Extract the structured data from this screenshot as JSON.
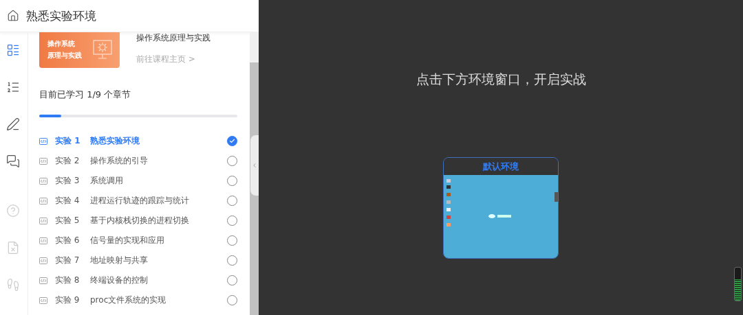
{
  "header": {
    "title": "熟悉实验环境"
  },
  "course": {
    "cover_lines": [
      "操作系统",
      "原理与实践"
    ],
    "name": "操作系统原理与实践",
    "link": "前往课程主页 >"
  },
  "progress": {
    "label": "目前已学习 1/9 个章节",
    "level": 0.11
  },
  "labs": [
    {
      "number": "实验 1",
      "title": "熟悉实验环境",
      "selected": true,
      "checked": true
    },
    {
      "number": "实验 2",
      "title": "操作系统的引导",
      "selected": false,
      "checked": false
    },
    {
      "number": "实验 3",
      "title": "系统调用",
      "selected": false,
      "checked": false
    },
    {
      "number": "实验 4",
      "title": "进程运行轨迹的跟踪与统计",
      "selected": false,
      "checked": false
    },
    {
      "number": "实验 5",
      "title": "基于内核栈切换的进程切换",
      "selected": false,
      "checked": false
    },
    {
      "number": "实验 6",
      "title": "信号量的实现和应用",
      "selected": false,
      "checked": false
    },
    {
      "number": "实验 7",
      "title": "地址映射与共享",
      "selected": false,
      "checked": false
    },
    {
      "number": "实验 8",
      "title": "终端设备的控制",
      "selected": false,
      "checked": false
    },
    {
      "number": "实验 9",
      "title": "proc文件系统的实现",
      "selected": false,
      "checked": false
    }
  ],
  "stage": {
    "prompt": "点击下方环境窗口，开启实战",
    "env_title": "默认环境",
    "meter": {
      "level": 0.65
    }
  }
}
